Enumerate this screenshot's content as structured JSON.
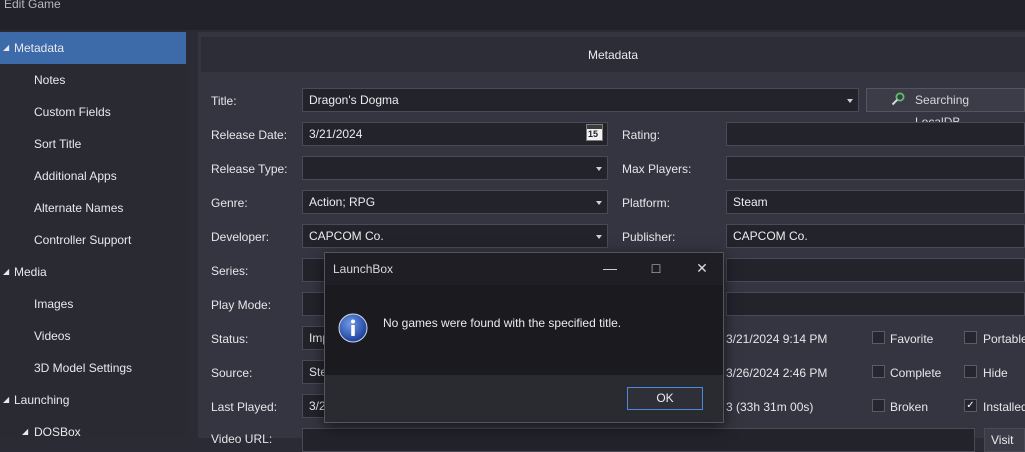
{
  "window": {
    "title": "Edit Game"
  },
  "sidebar": {
    "items": [
      {
        "label": "Metadata",
        "expanded": true,
        "selected": true
      },
      {
        "label": "Notes"
      },
      {
        "label": "Custom Fields"
      },
      {
        "label": "Sort Title"
      },
      {
        "label": "Additional Apps"
      },
      {
        "label": "Alternate Names"
      },
      {
        "label": "Controller Support"
      },
      {
        "label": "Media",
        "expanded": true
      },
      {
        "label": "Images"
      },
      {
        "label": "Videos"
      },
      {
        "label": "3D Model Settings"
      },
      {
        "label": "Launching",
        "expanded": true
      },
      {
        "label": "DOSBox",
        "expanded": true
      }
    ]
  },
  "header": {
    "title": "Metadata"
  },
  "form": {
    "title_label": "Title:",
    "title_value": "Dragon's Dogma",
    "search_button": "Searching LocalDB...",
    "release_date_label": "Release Date:",
    "release_date_value": "3/21/2024",
    "calendar_day": "15",
    "rating_label": "Rating:",
    "rating_value": "",
    "release_type_label": "Release Type:",
    "release_type_value": "",
    "max_players_label": "Max Players:",
    "max_players_value": "",
    "genre_label": "Genre:",
    "genre_value": "Action; RPG",
    "platform_label": "Platform:",
    "platform_value": "Steam",
    "developer_label": "Developer:",
    "developer_value": "CAPCOM Co.",
    "publisher_label": "Publisher:",
    "publisher_value": "CAPCOM Co.",
    "series_label": "Series:",
    "play_mode_label": "Play Mode:",
    "status_label": "Status:",
    "status_value": "Imp",
    "source_label": "Source:",
    "source_value": "Stea",
    "last_played_label": "Last Played:",
    "last_played_value": "3/2",
    "video_url_label": "Video URL:",
    "date_added": "3/21/2024 9:14 PM",
    "date_modified": "3/26/2024 2:46 PM",
    "play_time": "3 (33h 31m 00s)",
    "visit_button": "Visit"
  },
  "checkboxes": {
    "favorite": {
      "label": "Favorite",
      "checked": false
    },
    "portable": {
      "label": "Portable",
      "checked": false
    },
    "complete": {
      "label": "Complete",
      "checked": false
    },
    "hide": {
      "label": "Hide",
      "checked": false
    },
    "broken": {
      "label": "Broken",
      "checked": false
    },
    "installed": {
      "label": "Installed",
      "checked": true
    }
  },
  "dialog": {
    "title": "LaunchBox",
    "message": "No games were found with the specified title.",
    "ok_label": "OK",
    "icon": "info-icon"
  },
  "colors": {
    "selection": "#3d6aa8",
    "focus_border": "#4a8ad8"
  }
}
